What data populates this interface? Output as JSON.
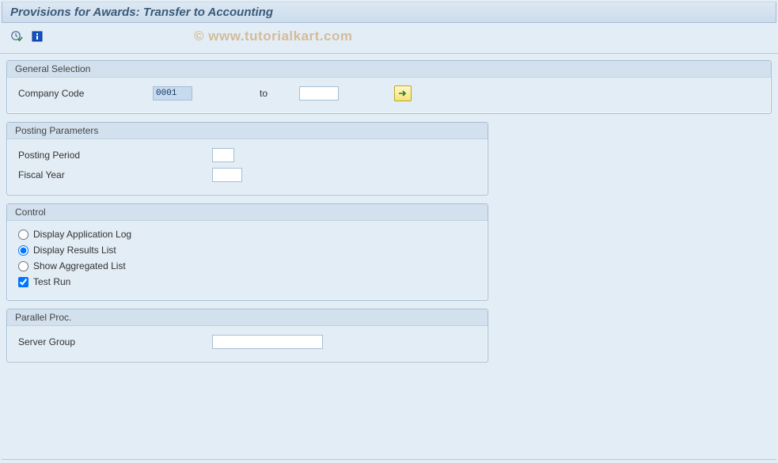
{
  "title": "Provisions for Awards: Transfer to Accounting",
  "watermark": "© www.tutorialkart.com",
  "toolbar": {
    "execute_icon": "execute",
    "info_icon": "info"
  },
  "general_selection": {
    "title": "General Selection",
    "company_code_label": "Company Code",
    "company_code_from": "0001",
    "to_label": "to",
    "company_code_to": "",
    "multi_select_icon": "arrow-right"
  },
  "posting_parameters": {
    "title": "Posting Parameters",
    "posting_period_label": "Posting Period",
    "posting_period_value": "",
    "fiscal_year_label": "Fiscal Year",
    "fiscal_year_value": ""
  },
  "control": {
    "title": "Control",
    "display_app_log": "Display Application Log",
    "display_results": "Display Results List",
    "show_aggregated": "Show Aggregated List",
    "test_run": "Test Run",
    "selected": "display_results",
    "test_run_checked": true
  },
  "parallel_proc": {
    "title": "Parallel Proc.",
    "server_group_label": "Server Group",
    "server_group_value": ""
  }
}
